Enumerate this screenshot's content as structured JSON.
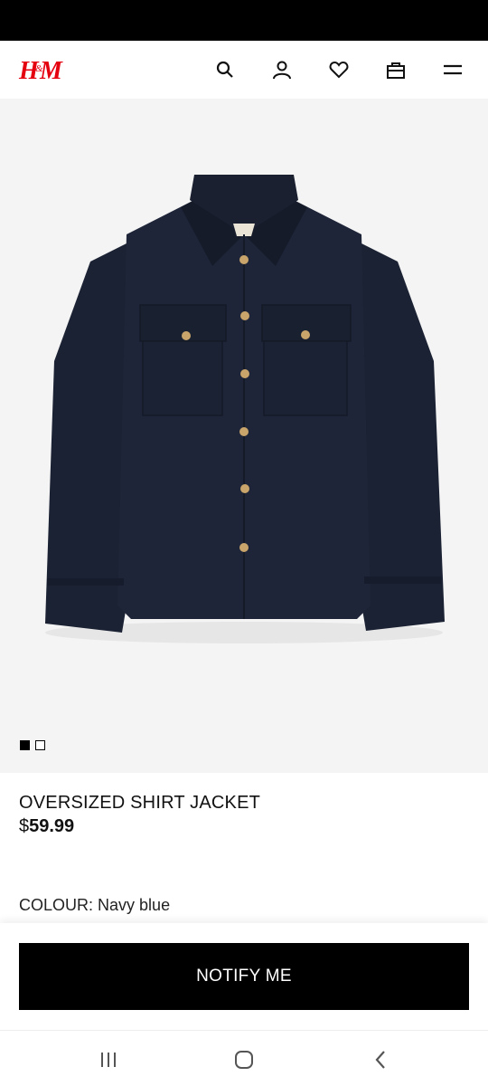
{
  "brand": {
    "logo_text": "H&M",
    "color": "#e50010"
  },
  "header": {
    "icons": [
      "search-icon",
      "account-icon",
      "heart-icon",
      "shopping-bag-icon",
      "menu-icon"
    ]
  },
  "gallery": {
    "image_count": 2,
    "active_index": 0,
    "jacket_color": "#1b2233",
    "button_color": "#c9a56b"
  },
  "product": {
    "title": "OVERSIZED SHIRT JACKET",
    "price_currency": "$",
    "price_value": "59.99",
    "colour_label": "COLOUR:",
    "colour_value": "Navy blue"
  },
  "cta": {
    "label": "NOTIFY ME"
  },
  "system_nav": {
    "icons": [
      "recents-icon",
      "home-icon",
      "back-icon"
    ]
  }
}
